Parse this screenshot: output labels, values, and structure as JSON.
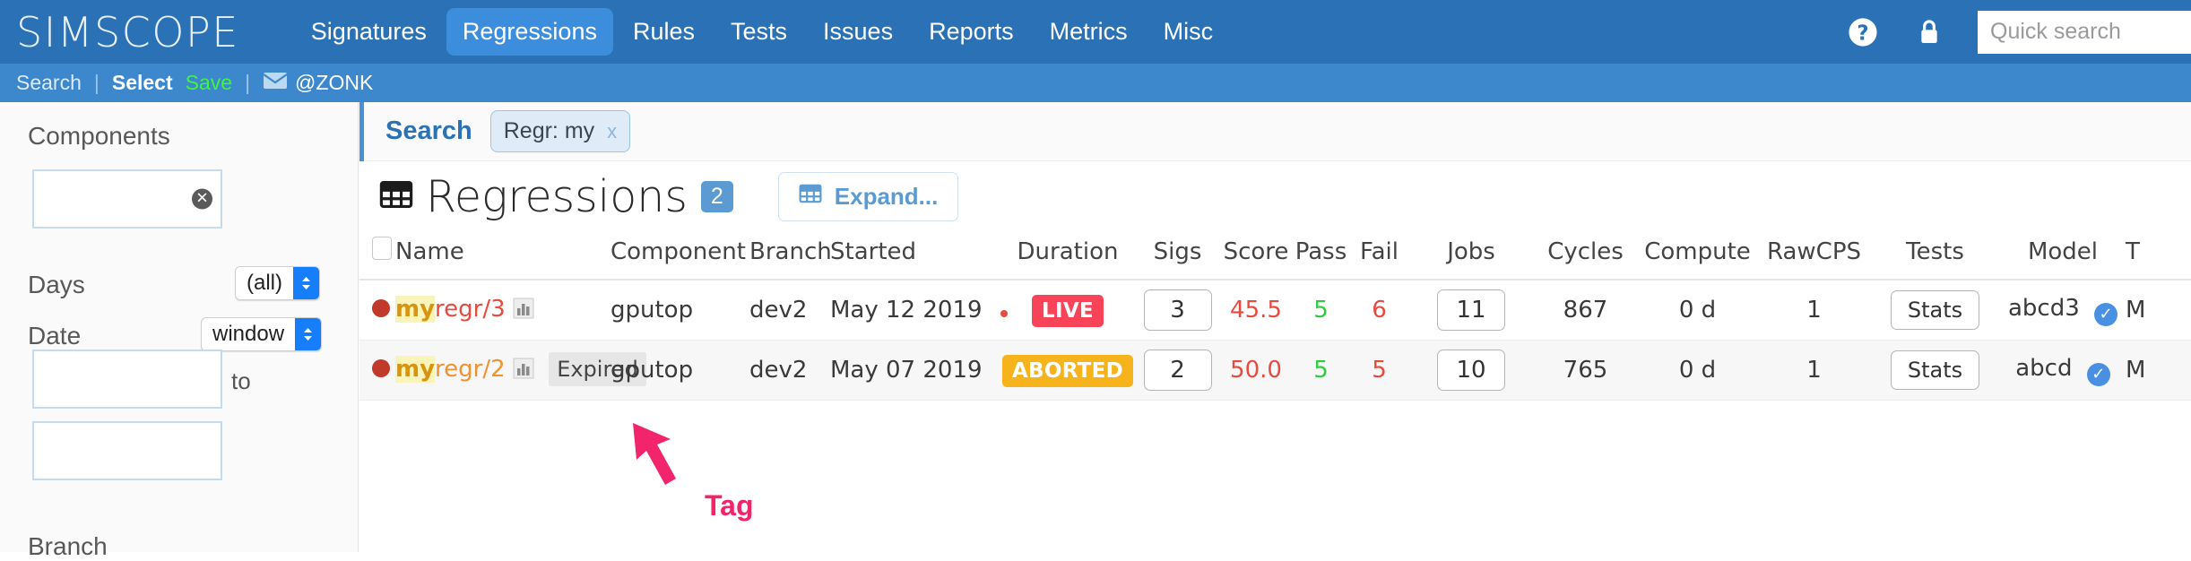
{
  "brand": "SIMSCOPE",
  "topnav": {
    "items": [
      {
        "label": "Signatures",
        "active": false
      },
      {
        "label": "Regressions",
        "active": true
      },
      {
        "label": "Rules",
        "active": false
      },
      {
        "label": "Tests",
        "active": false
      },
      {
        "label": "Issues",
        "active": false
      },
      {
        "label": "Reports",
        "active": false
      },
      {
        "label": "Metrics",
        "active": false
      },
      {
        "label": "Misc",
        "active": false
      }
    ],
    "help_icon": "question-mark-circle-icon",
    "lock_icon": "lock-icon",
    "quick_search_placeholder": "Quick search",
    "quick_search_value": "",
    "bg_color": "#2a72b5",
    "active_color": "#3d8ddd"
  },
  "subnav": {
    "search": "Search",
    "sep1": "|",
    "select": "Select",
    "save": "Save",
    "sep2": "|",
    "mail_icon": "envelope-icon",
    "user": "@ZONK",
    "bg_color": "#3d87cd",
    "save_color": "#3df53d"
  },
  "sidebar": {
    "components_label": "Components",
    "components_value": "",
    "clear_icon": "clear-circle-x-icon",
    "days_label": "Days",
    "days_value": "(all)",
    "date_label": "Date",
    "date_value": "window",
    "date_from_value": "",
    "date_to_label": "to",
    "date_to_value": "",
    "branch_label": "Branch"
  },
  "searchbar": {
    "label": "Search",
    "chips": [
      {
        "text": "Regr:  my",
        "close": "x"
      }
    ]
  },
  "heading": {
    "grid_icon": "table-grid-icon",
    "title": "Regressions",
    "count": "2",
    "expand_icon": "table-grid-icon",
    "expand_label": "Expand..."
  },
  "table": {
    "columns": [
      "",
      "Name",
      "Component",
      "Branch",
      "Started",
      "Duration",
      "Sigs",
      "Score",
      "Pass",
      "Fail",
      "Jobs",
      "Cycles",
      "Compute",
      "RawCPS",
      "Tests",
      "Model",
      "T"
    ],
    "rows": [
      {
        "status_dot": "red",
        "name_prefix": "my",
        "name_suffix": "regr/3",
        "name_color": "red",
        "chart_icon": "bar-chart-icon",
        "tag": "",
        "component": "gputop",
        "branch": "dev2",
        "started": "May 12 2019",
        "started_dot": true,
        "duration": "LIVE",
        "duration_kind": "live",
        "sigs": "3",
        "score": "45.5",
        "pass": "5",
        "fail": "6",
        "jobs": "11",
        "cycles": "867",
        "compute": "0 d",
        "rawcps": "1",
        "tests": "Stats",
        "model": "abcd3",
        "model_verified": true,
        "trailing": "M"
      },
      {
        "status_dot": "red",
        "name_prefix": "my",
        "name_suffix": "regr/2",
        "name_color": "orange",
        "chart_icon": "bar-chart-icon",
        "tag": "Expired",
        "component": "gputop",
        "branch": "dev2",
        "started": "May 07 2019",
        "started_dot": false,
        "duration": "ABORTED",
        "duration_kind": "aborted",
        "sigs": "2",
        "score": "50.0",
        "pass": "5",
        "fail": "5",
        "jobs": "10",
        "cycles": "765",
        "compute": "0 d",
        "rawcps": "1",
        "tests": "Stats",
        "model": "abcd",
        "model_verified": true,
        "trailing": "M"
      }
    ]
  },
  "annotation": {
    "arrow_icon": "pointer-arrow-annotation",
    "label": "Tag",
    "color": "#f2246b"
  }
}
